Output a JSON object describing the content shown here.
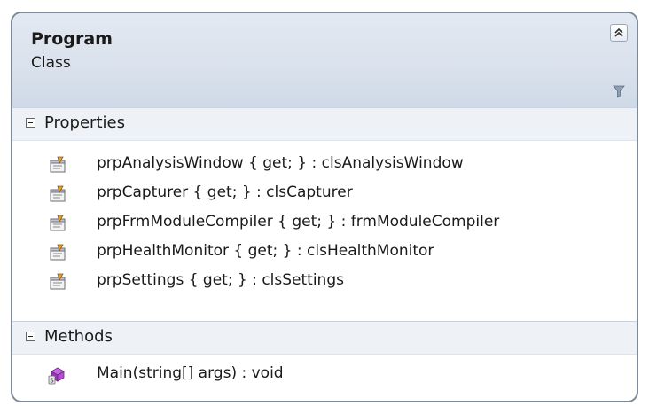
{
  "class": {
    "name": "Program",
    "kind": "Class"
  },
  "sections": {
    "properties": {
      "label": "Properties",
      "items": [
        "prpAnalysisWindow { get; } : clsAnalysisWindow",
        "prpCapturer { get; } : clsCapturer",
        "prpFrmModuleCompiler { get; } : frmModuleCompiler",
        "prpHealthMonitor { get; } : clsHealthMonitor",
        "prpSettings { get; } : clsSettings"
      ]
    },
    "methods": {
      "label": "Methods",
      "items": [
        "Main(string[] args) : void"
      ]
    }
  },
  "icons": {
    "collapse": "double-chevron-up-icon",
    "filter": "filter-icon",
    "property": "property-icon",
    "method": "static-method-icon"
  },
  "colors": {
    "border": "#7f8a99",
    "header_bg": "#d9e1ec",
    "method_icon": "#b24fd0"
  }
}
